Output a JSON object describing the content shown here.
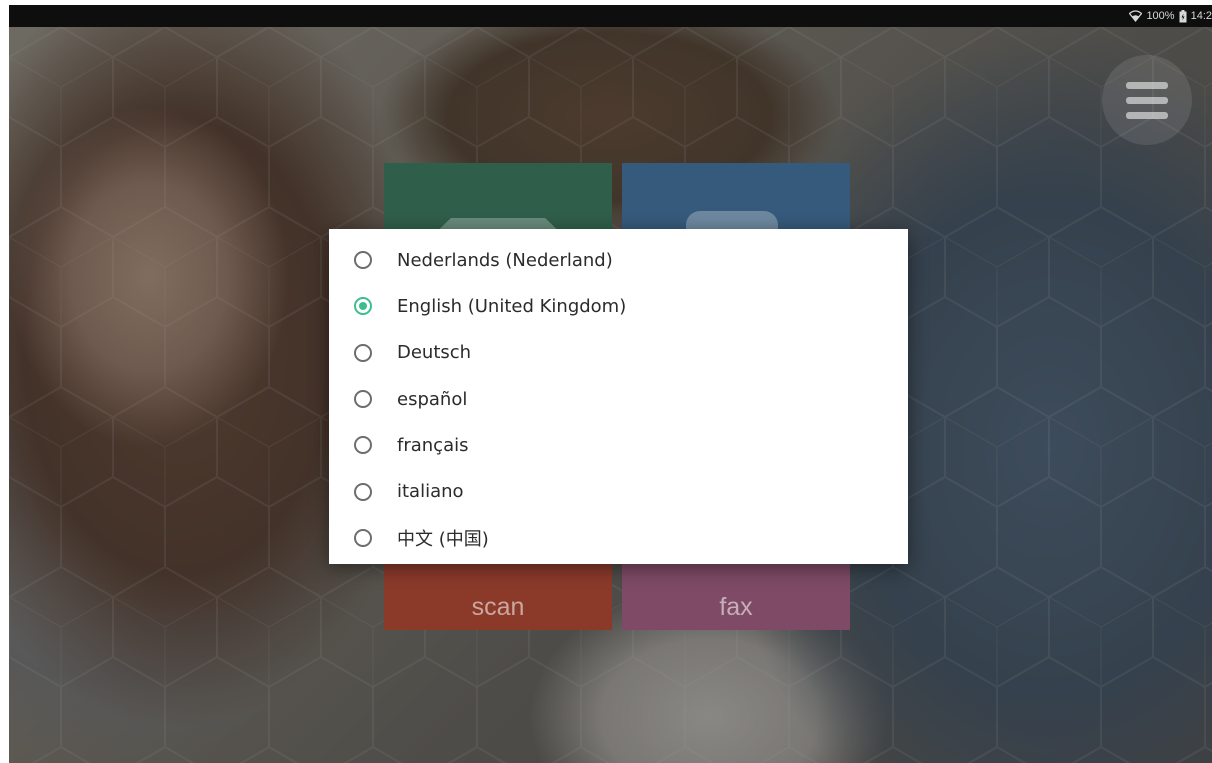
{
  "status_bar": {
    "battery_text": "100%",
    "time": "14:2",
    "wifi_icon": "wifi-icon",
    "battery_icon": "battery-icon"
  },
  "menu": {
    "icon": "hamburger-menu-icon"
  },
  "tiles": [
    {
      "id": "copy",
      "label": "",
      "color": "#2f5e4a"
    },
    {
      "id": "print",
      "label": "",
      "color": "#365a7c"
    },
    {
      "id": "scan",
      "label": "scan",
      "color": "#8b3a2a"
    },
    {
      "id": "fax",
      "label": "fax",
      "color": "#7e4a66"
    }
  ],
  "language_dialog": {
    "selected_index": 1,
    "accent_color": "#3ebd8e",
    "options": [
      {
        "label": "Nederlands (Nederland)"
      },
      {
        "label": "English (United Kingdom)"
      },
      {
        "label": "Deutsch"
      },
      {
        "label": "español"
      },
      {
        "label": "français"
      },
      {
        "label": "italiano"
      },
      {
        "label": "中文 (中国)"
      }
    ]
  }
}
